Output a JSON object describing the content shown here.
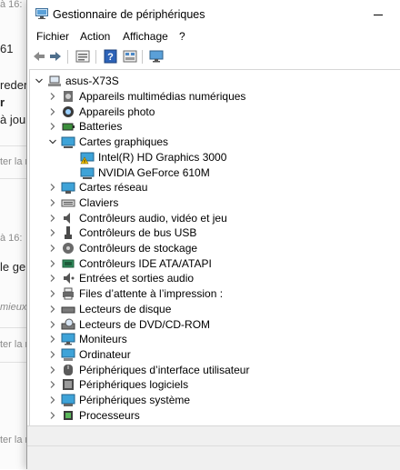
{
  "background": {
    "fragments": [
      "à 16:",
      "61",
      "reden",
      "r",
      "à jou",
      "ter la r",
      "à 16:",
      "le ge",
      "mieux d",
      "ter la r",
      "ter la r"
    ]
  },
  "window": {
    "title": "Gestionnaire de périphériques",
    "menu": [
      "Fichier",
      "Action",
      "Affichage",
      "?"
    ]
  },
  "toolbar": {
    "buttons": [
      "back-arrow-icon",
      "forward-arrow-icon",
      "properties-icon",
      "help-icon",
      "view-icon",
      "monitor-icon"
    ]
  },
  "tree": {
    "root": "asus-X73S",
    "items": [
      {
        "label": "Appareils multimédias numériques",
        "icon": "multimedia-icon",
        "expanded": false
      },
      {
        "label": "Appareils photo",
        "icon": "camera-icon",
        "expanded": false
      },
      {
        "label": "Batteries",
        "icon": "battery-icon",
        "expanded": false
      },
      {
        "label": "Cartes graphiques",
        "icon": "display-adapter-icon",
        "expanded": true
      },
      {
        "label": "Intel(R) HD Graphics 3000",
        "icon": "warning-display-icon",
        "child": true
      },
      {
        "label": "NVIDIA GeForce 610M",
        "icon": "display-adapter-icon",
        "child": true
      },
      {
        "label": "Cartes réseau",
        "icon": "network-icon",
        "expanded": false
      },
      {
        "label": "Claviers",
        "icon": "keyboard-icon",
        "expanded": false
      },
      {
        "label": "Contrôleurs audio, vidéo et jeu",
        "icon": "speaker-icon",
        "expanded": false
      },
      {
        "label": "Contrôleurs de bus USB",
        "icon": "usb-icon",
        "expanded": false
      },
      {
        "label": "Contrôleurs de stockage",
        "icon": "storage-icon",
        "expanded": false
      },
      {
        "label": "Contrôleurs IDE ATA/ATAPI",
        "icon": "ide-icon",
        "expanded": false
      },
      {
        "label": "Entrées et sorties audio",
        "icon": "audio-io-icon",
        "expanded": false
      },
      {
        "label": "Files d’attente à l’impression :",
        "icon": "printer-icon",
        "expanded": false
      },
      {
        "label": "Lecteurs de disque",
        "icon": "disk-drive-icon",
        "expanded": false
      },
      {
        "label": "Lecteurs de DVD/CD-ROM",
        "icon": "dvd-icon",
        "expanded": false
      },
      {
        "label": "Moniteurs",
        "icon": "monitor-icon",
        "expanded": false
      },
      {
        "label": "Ordinateur",
        "icon": "computer-icon",
        "expanded": false
      },
      {
        "label": "Périphériques d’interface utilisateur",
        "icon": "hid-icon",
        "expanded": false
      },
      {
        "label": "Périphériques logiciels",
        "icon": "software-device-icon",
        "expanded": false
      },
      {
        "label": "Périphériques système",
        "icon": "system-device-icon",
        "expanded": false
      },
      {
        "label": "Processeurs",
        "icon": "processor-icon",
        "expanded": false
      }
    ]
  }
}
